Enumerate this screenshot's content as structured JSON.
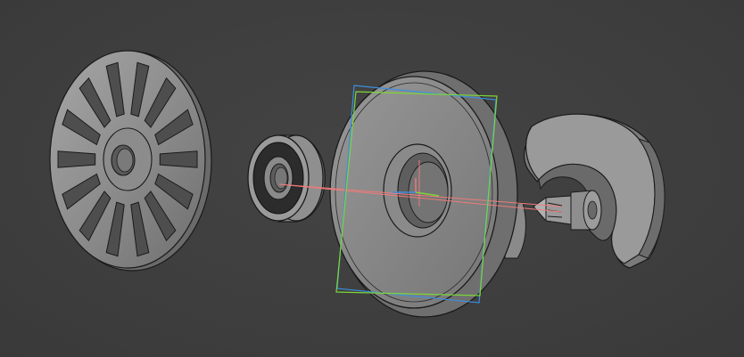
{
  "viewport": {
    "background": "#3f3f3f"
  },
  "parts": [
    {
      "id": "vent-cover",
      "icon": "slotted-disc"
    },
    {
      "id": "ball-bearing",
      "icon": "bearing-ring"
    },
    {
      "id": "main-rotor-disc",
      "icon": "large-disc-with-hub",
      "selected": true
    },
    {
      "id": "volute-housing",
      "icon": "spiral-housing"
    },
    {
      "id": "drive-shaft",
      "icon": "shaft-with-tip"
    }
  ],
  "overlay": {
    "selection_box_color": "#7cd63a",
    "selection_box_alt_color": "#3b8fe0",
    "axis_line_color": "#f07a7a",
    "gizmo_colors": {
      "x": "#f07a7a",
      "y": "#7cd63a",
      "z": "#3b8fe0"
    }
  },
  "colors": {
    "part_face": "#8a8a8a",
    "part_face_light": "#a0a0a0",
    "part_face_dark": "#5e5e5e",
    "outline": "#1a1a1a"
  }
}
